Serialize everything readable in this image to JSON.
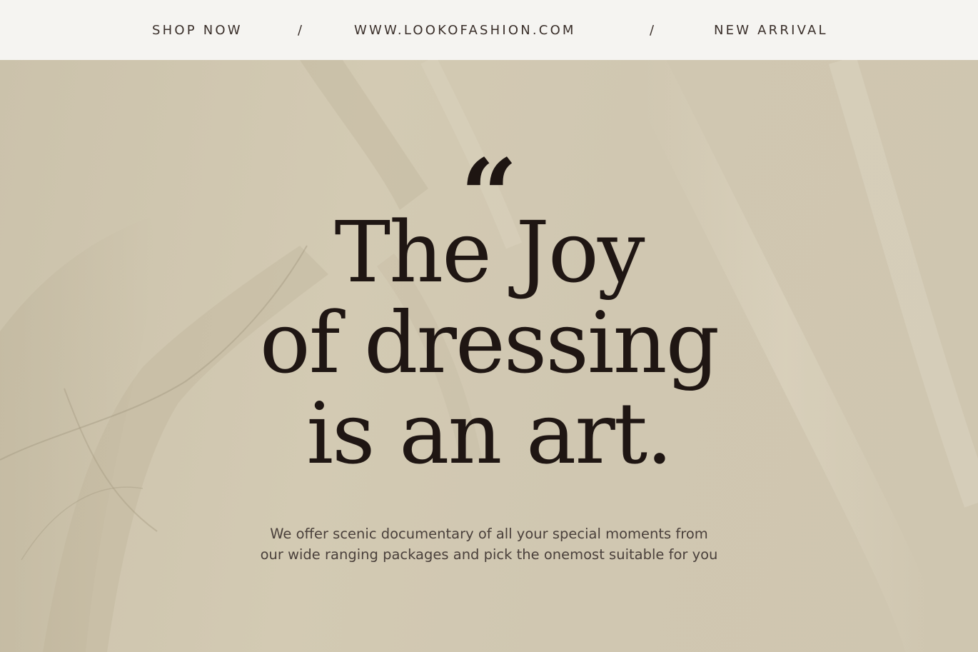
{
  "nav": {
    "shop_now": "SHOP NOW",
    "separator": "/",
    "website": "WWW.LOOKOFASHION.COM",
    "new_arrival": "NEW ARRIVAL"
  },
  "hero": {
    "quote_mark": "“",
    "headline_lines": [
      "The Joy",
      "of dressing",
      "is an art."
    ],
    "subtext_lines": [
      "We offer scenic documentary of all your special moments from",
      "our wide ranging packages and pick the onemost suitable for you"
    ]
  },
  "colors": {
    "nav_background": "#f5f4f1",
    "hero_background": "#cfc6b0",
    "text_dark": "#1f1613",
    "text_muted": "#4a403b"
  },
  "icons": {
    "quote": "open-quote-icon"
  }
}
